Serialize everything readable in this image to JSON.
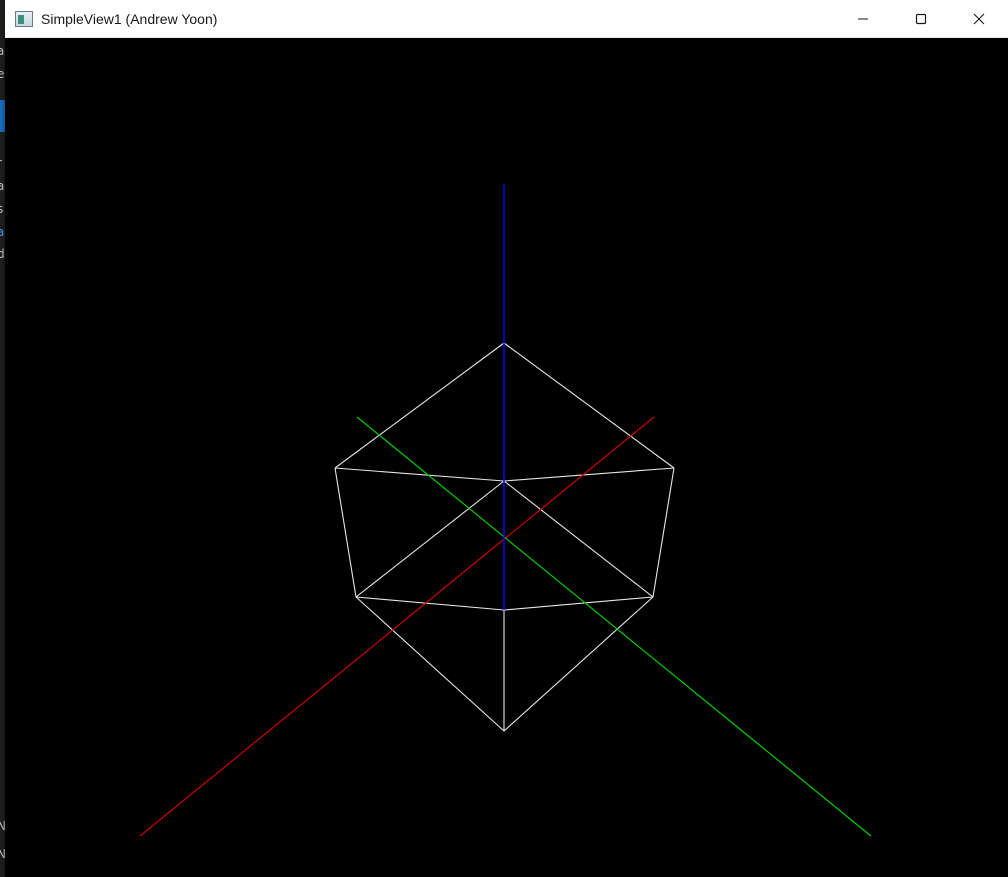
{
  "window": {
    "title": "SimpleView1 (Andrew Yoon)",
    "icon": "app-window-icon",
    "controls": [
      {
        "name": "minimize-button",
        "icon": "minimize-icon"
      },
      {
        "name": "maximize-button",
        "icon": "maximize-icon"
      },
      {
        "name": "close-button",
        "icon": "close-icon"
      }
    ]
  },
  "viewport": {
    "background": "#000000",
    "axes": {
      "x_color": "#cc0000",
      "y_color": "#00cc00",
      "z_color": "#0000ff"
    },
    "cube_color": "#e6e6e6"
  },
  "background_app": {
    "visible_chars": [
      "a",
      "e",
      "r",
      "a",
      "s",
      "a",
      "d",
      "N",
      "N"
    ]
  }
}
